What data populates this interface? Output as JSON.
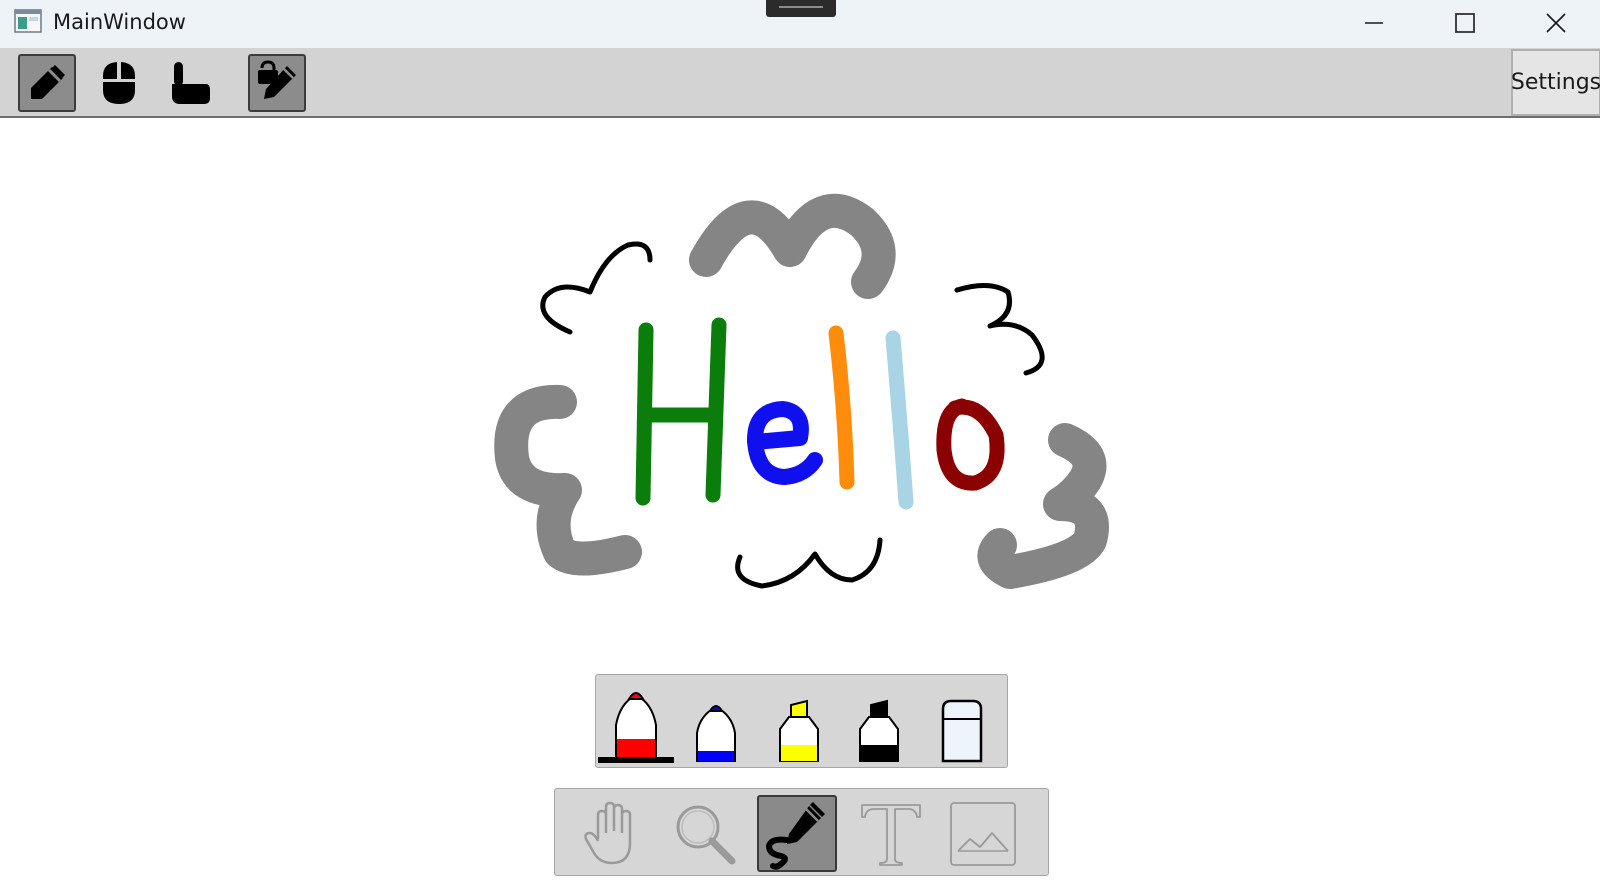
{
  "window": {
    "title": "MainWindow",
    "app_icon": "app-window-icon",
    "controls": [
      "minimize-icon",
      "maximize-icon",
      "close-icon"
    ]
  },
  "toolbar": {
    "buttons": [
      {
        "name": "pen-input-button",
        "icon": "pen-icon",
        "active": true
      },
      {
        "name": "mouse-input-button",
        "icon": "mouse-icon",
        "active": false
      },
      {
        "name": "touch-input-button",
        "icon": "pointing-hand-icon",
        "active": false
      },
      {
        "name": "lock-edit-button",
        "icon": "lock-pencil-icon",
        "active": true
      }
    ],
    "settings_label": "Settings"
  },
  "canvas": {
    "colors": {
      "green": "#0a7d0a",
      "blue": "#1010ee",
      "orange": "#ff8c0a",
      "light_blue": "#a8d4e6",
      "dark_red": "#8b0000",
      "gray": "#858585",
      "black": "#000000"
    }
  },
  "pen_palette": {
    "tools": [
      {
        "name": "red-marker",
        "icon": "red-marker-icon",
        "color": "#ff0000",
        "selected": true
      },
      {
        "name": "blue-marker",
        "icon": "blue-marker-icon",
        "color": "#0000ff",
        "selected": false
      },
      {
        "name": "yellow-highlighter",
        "icon": "yellow-highlighter-icon",
        "color": "#ffff00",
        "selected": false
      },
      {
        "name": "black-highlighter",
        "icon": "black-highlighter-icon",
        "color": "#000000",
        "selected": false
      },
      {
        "name": "eraser",
        "icon": "eraser-icon",
        "color": "#eef4fb",
        "selected": false
      }
    ]
  },
  "mode_palette": {
    "modes": [
      {
        "name": "pan-mode",
        "icon": "hand-icon",
        "active": false
      },
      {
        "name": "zoom-mode",
        "icon": "magnifier-icon",
        "active": false
      },
      {
        "name": "ink-mode",
        "icon": "pen-scribble-icon",
        "active": true
      },
      {
        "name": "text-mode",
        "icon": "text-icon",
        "active": false
      },
      {
        "name": "image-mode",
        "icon": "image-icon",
        "active": false
      }
    ]
  }
}
